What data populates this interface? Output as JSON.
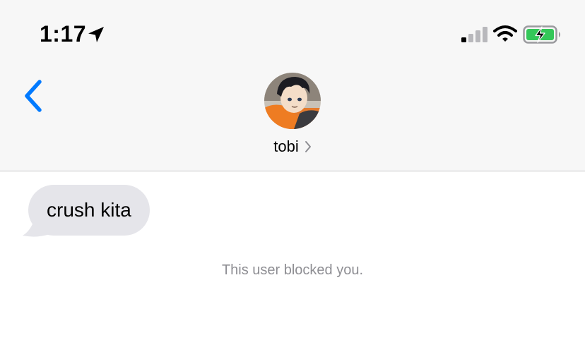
{
  "status_bar": {
    "time": "1:17",
    "icons": [
      "location-arrow-icon",
      "cellular-signal-icon",
      "wifi-icon",
      "battery-charging-icon"
    ],
    "signal_bars_active": 1,
    "signal_bars_total": 4,
    "battery_color": "#34c759"
  },
  "nav": {
    "back_icon": "chevron-left-icon",
    "contact": {
      "name": "tobi",
      "avatar": "contact-avatar"
    },
    "accent_color": "#007aff"
  },
  "conversation": {
    "messages": [
      {
        "direction": "received",
        "text": "crush kita"
      }
    ],
    "system_notice": "This user blocked you."
  }
}
